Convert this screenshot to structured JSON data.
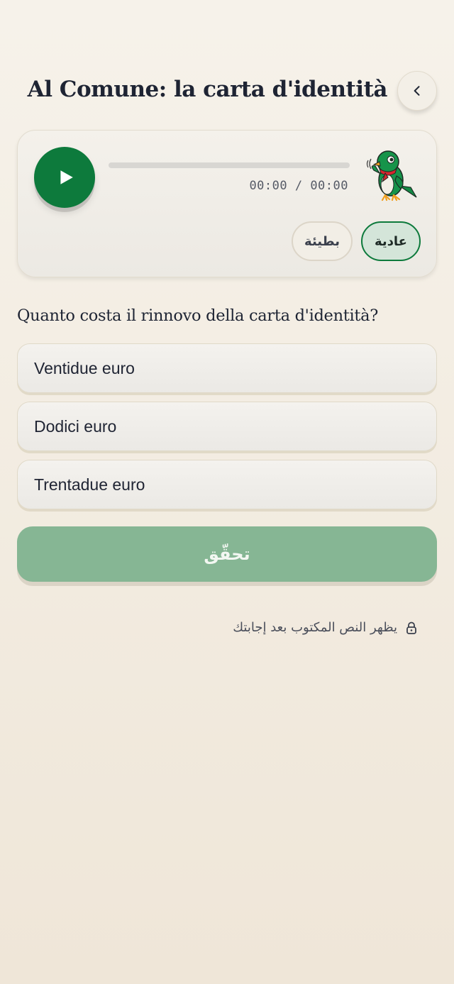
{
  "header": {
    "title": "Al Comune: la carta d'identità",
    "back_icon": "chevron-left-icon"
  },
  "audio": {
    "play_icon": "play-icon",
    "time_display": "00:00 / 00:00",
    "progress": 0,
    "speed_normal_label": "عادية",
    "speed_slow_label": "بطيئة",
    "selected_speed": "normal"
  },
  "quiz": {
    "question": "Quanto costa il rinnovo della carta d'identità?",
    "options": [
      "Ventidue euro",
      "Dodici euro",
      "Trentadue euro"
    ],
    "check_label": "تحقّق"
  },
  "hint": {
    "text": "يظهر النص المكتوب بعد إجابتك",
    "icon": "lock-icon"
  },
  "colors": {
    "accent": "#0d7a3c",
    "check_button_disabled": "#86b694",
    "background": "#f3ede2"
  }
}
